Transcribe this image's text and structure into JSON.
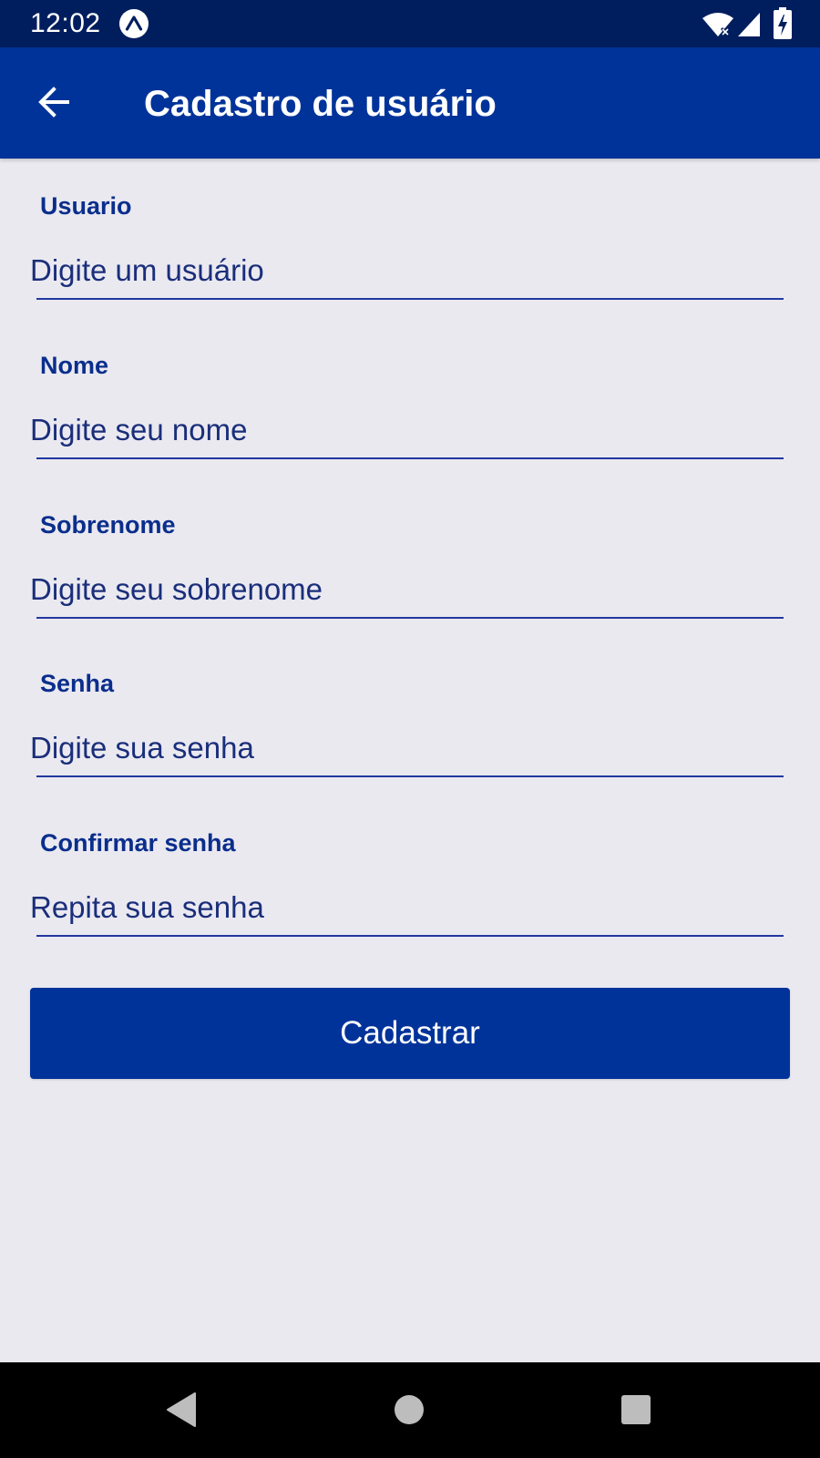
{
  "status_bar": {
    "time": "12:02",
    "icons": [
      "expo-icon",
      "wifi-icon",
      "signal-icon",
      "battery-charging-icon"
    ]
  },
  "app_bar": {
    "back_icon": "arrow-left-icon",
    "title": "Cadastro de usuário"
  },
  "form": {
    "fields": [
      {
        "label": "Usuario",
        "placeholder": "Digite um usuário",
        "value": ""
      },
      {
        "label": "Nome",
        "placeholder": "Digite seu nome",
        "value": ""
      },
      {
        "label": "Sobrenome",
        "placeholder": "Digite seu sobrenome",
        "value": ""
      },
      {
        "label": "Senha",
        "placeholder": "Digite sua senha",
        "value": ""
      },
      {
        "label": "Confirmar senha",
        "placeholder": "Repita sua senha",
        "value": ""
      }
    ],
    "submit_label": "Cadastrar"
  },
  "nav_bar": {
    "icons": [
      "nav-back-icon",
      "nav-home-icon",
      "nav-recent-icon"
    ]
  },
  "colors": {
    "primary": "#003399",
    "status_bar": "#001E5E",
    "background": "#EAE9F0",
    "label_text": "#0A2E8C",
    "nav_bar": "#000000"
  }
}
